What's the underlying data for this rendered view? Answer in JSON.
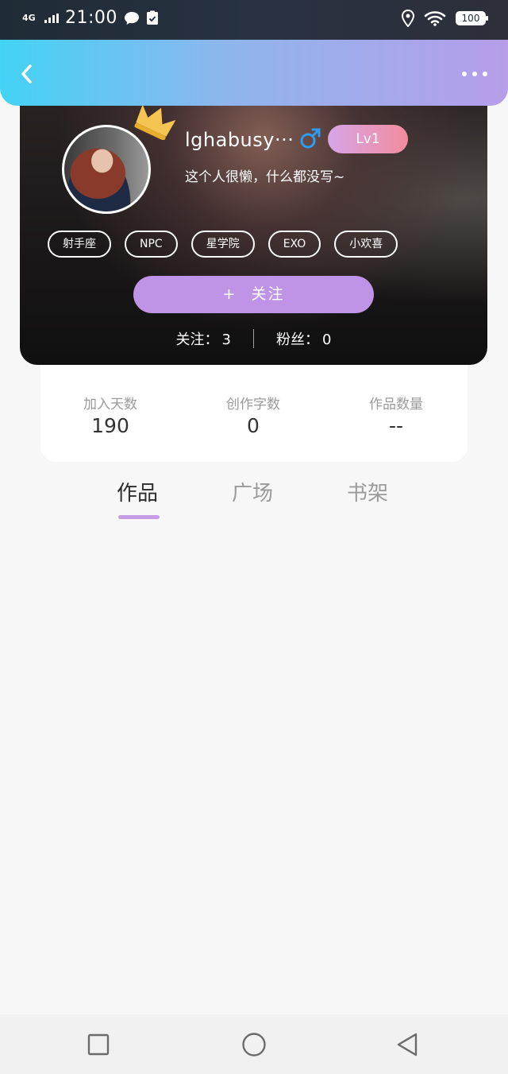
{
  "status_bar": {
    "network": "4G",
    "time": "21:00",
    "battery": "100"
  },
  "profile": {
    "username": "lghabusy···",
    "level": "Lv1",
    "bio": "这个人很懒，什么都没写~",
    "tags": [
      "射手座",
      "NPC",
      "星学院",
      "EXO",
      "小欢喜"
    ],
    "follow_plus": "+",
    "follow_label": "关注",
    "following_label": "关注：",
    "following_count": "3",
    "fans_label": "粉丝：",
    "fans_count": "0"
  },
  "stats": [
    {
      "label": "加入天数",
      "value": "190"
    },
    {
      "label": "创作字数",
      "value": "0"
    },
    {
      "label": "作品数量",
      "value": "--"
    }
  ],
  "tabs": [
    {
      "label": "作品",
      "active": true
    },
    {
      "label": "广场",
      "active": false
    },
    {
      "label": "书架",
      "active": false
    }
  ],
  "colors": {
    "header_gradient_start": "#43d3f4",
    "header_gradient_end": "#b69ee9",
    "accent_purple": "#bf94e6",
    "gender_blue": "#2e9cf2",
    "crown_gold": "#f6c453"
  },
  "icons": {
    "back": "chevron-left-icon",
    "more": "more-dots-icon",
    "gender": "male-icon",
    "crown": "crown-icon",
    "nav_recents": "square-icon",
    "nav_home": "circle-icon",
    "nav_back": "triangle-back-icon"
  }
}
